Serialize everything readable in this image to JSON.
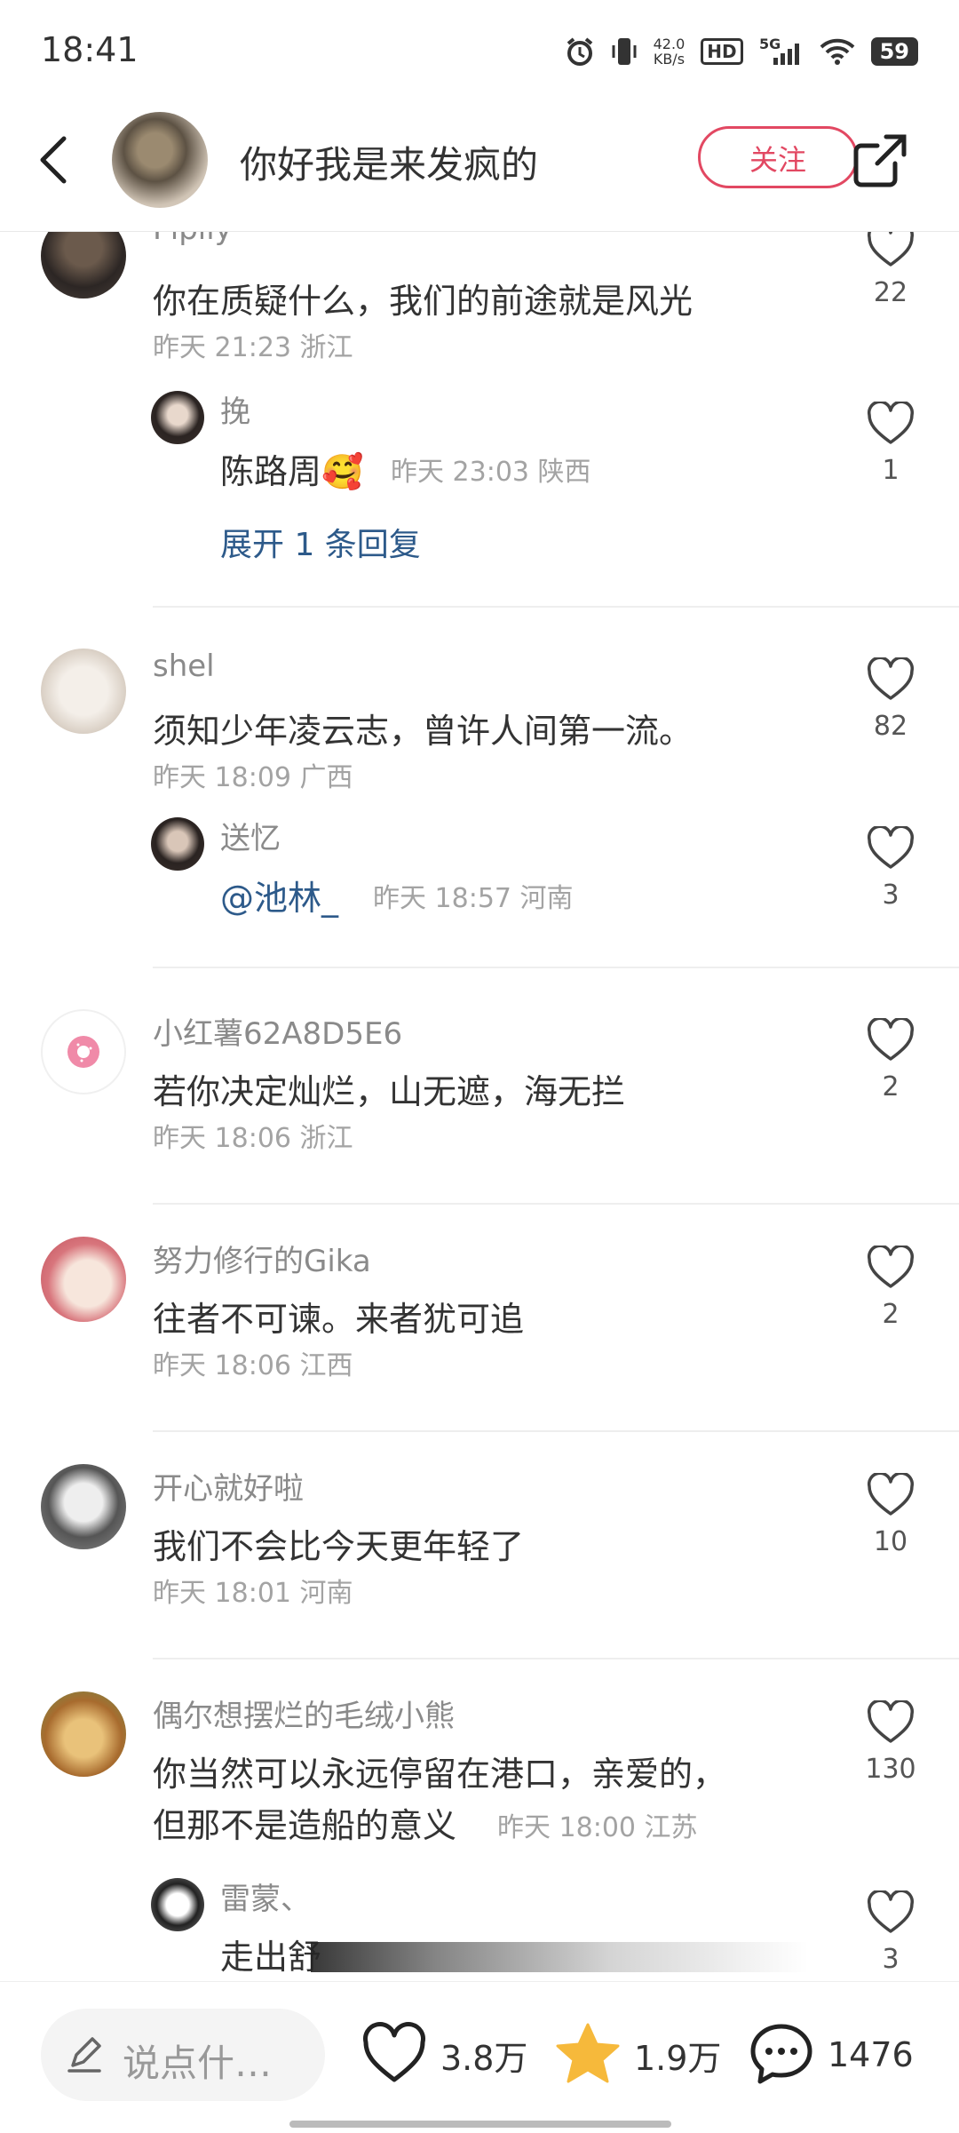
{
  "status_bar": {
    "time": "18:41",
    "net_speed": "42.0",
    "net_unit": "KB/s",
    "hd": "HD",
    "network": "5G",
    "battery": "59"
  },
  "header": {
    "author_name": "你好我是来发疯的",
    "follow_label": "关注"
  },
  "comments": [
    {
      "user": "Pipiiy",
      "text": "你在质疑什么，我们的前途就是风光",
      "time": "昨天 21:23",
      "region": "浙江",
      "likes": "22",
      "reply": {
        "user": "挽",
        "text": "陈路周🥰",
        "time": "昨天 23:03",
        "region": "陕西",
        "likes": "1"
      },
      "expand_label": "展开 1 条回复"
    },
    {
      "user": "shel",
      "text": "须知少年凌云志，曾许人间第一流。",
      "time": "昨天 18:09",
      "region": "广西",
      "likes": "82",
      "reply": {
        "user": "送忆",
        "text": "@池林_",
        "time": "昨天 18:57",
        "region": "河南",
        "likes": "3"
      }
    },
    {
      "user": "小红薯62A8D5E6",
      "text": "若你决定灿烂，山无遮，海无拦",
      "time": "昨天 18:06",
      "region": "浙江",
      "likes": "2"
    },
    {
      "user": "努力修行的Gika",
      "text": "往者不可谏。来者犹可追",
      "time": "昨天 18:06",
      "region": "江西",
      "likes": "2"
    },
    {
      "user": "开心就好啦",
      "text": "我们不会比今天更年轻了",
      "time": "昨天 18:01",
      "region": "河南",
      "likes": "10"
    },
    {
      "user": "偶尔想摆烂的毛绒小熊",
      "text_line1": "你当然可以永远停留在港口，亲爱的，",
      "text_line2": "但那不是造船的意义",
      "time": "昨天 18:00",
      "region": "江苏",
      "likes": "130",
      "reply": {
        "user": "雷蒙、",
        "text": "走出舒",
        "likes": "3"
      }
    }
  ],
  "bottom_bar": {
    "input_placeholder": "说点什…",
    "likes": "3.8万",
    "collects": "1.9万",
    "comments": "1476"
  },
  "colors": {
    "accent": "#e24862",
    "link": "#2d5a8a",
    "star": "#f6b93b"
  }
}
